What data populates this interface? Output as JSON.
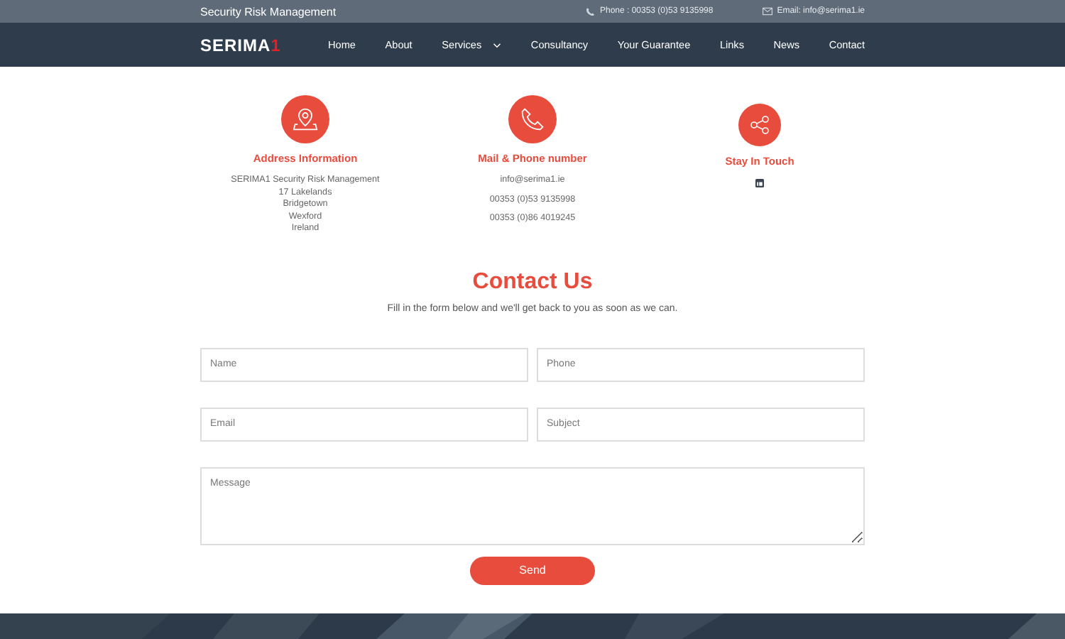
{
  "top_bar": {
    "tagline": "Security Risk Management",
    "phone": "Phone : 00353 (0)53 9135998",
    "email": "Email: info@serima1.ie"
  },
  "logo": {
    "text": "SERIMA",
    "accent": "1"
  },
  "nav": [
    {
      "label": "Home",
      "dropdown": false
    },
    {
      "label": "About",
      "dropdown": false
    },
    {
      "label": "Services",
      "dropdown": true
    },
    {
      "label": "Consultancy",
      "dropdown": false
    },
    {
      "label": "Your Guarantee",
      "dropdown": false
    },
    {
      "label": "Links",
      "dropdown": false
    },
    {
      "label": "News",
      "dropdown": false
    },
    {
      "label": "Contact",
      "dropdown": false
    }
  ],
  "info": [
    {
      "kind": "address",
      "title": "Address Information",
      "lines": [
        "SERIMA1 Security Risk Management",
        "17 Lakelands",
        "Bridgetown",
        "Wexford",
        "Ireland"
      ]
    },
    {
      "kind": "phone",
      "title": "Mail & Phone number",
      "lines": [
        "info@serima1.ie",
        "00353 (0)53 9135998",
        "00353 (0)86 4019245"
      ]
    },
    {
      "kind": "social",
      "title": "Stay In Touch"
    }
  ],
  "contact": {
    "title": "Contact Us",
    "subtitle": "Fill in the form below and we'll get back to you as soon as we can.",
    "fields": [
      {
        "placeholder": "Name"
      },
      {
        "placeholder": "Phone"
      },
      {
        "placeholder": "Email"
      },
      {
        "placeholder": "Subject"
      }
    ],
    "message": {
      "placeholder": "Message"
    },
    "button": "Send"
  }
}
